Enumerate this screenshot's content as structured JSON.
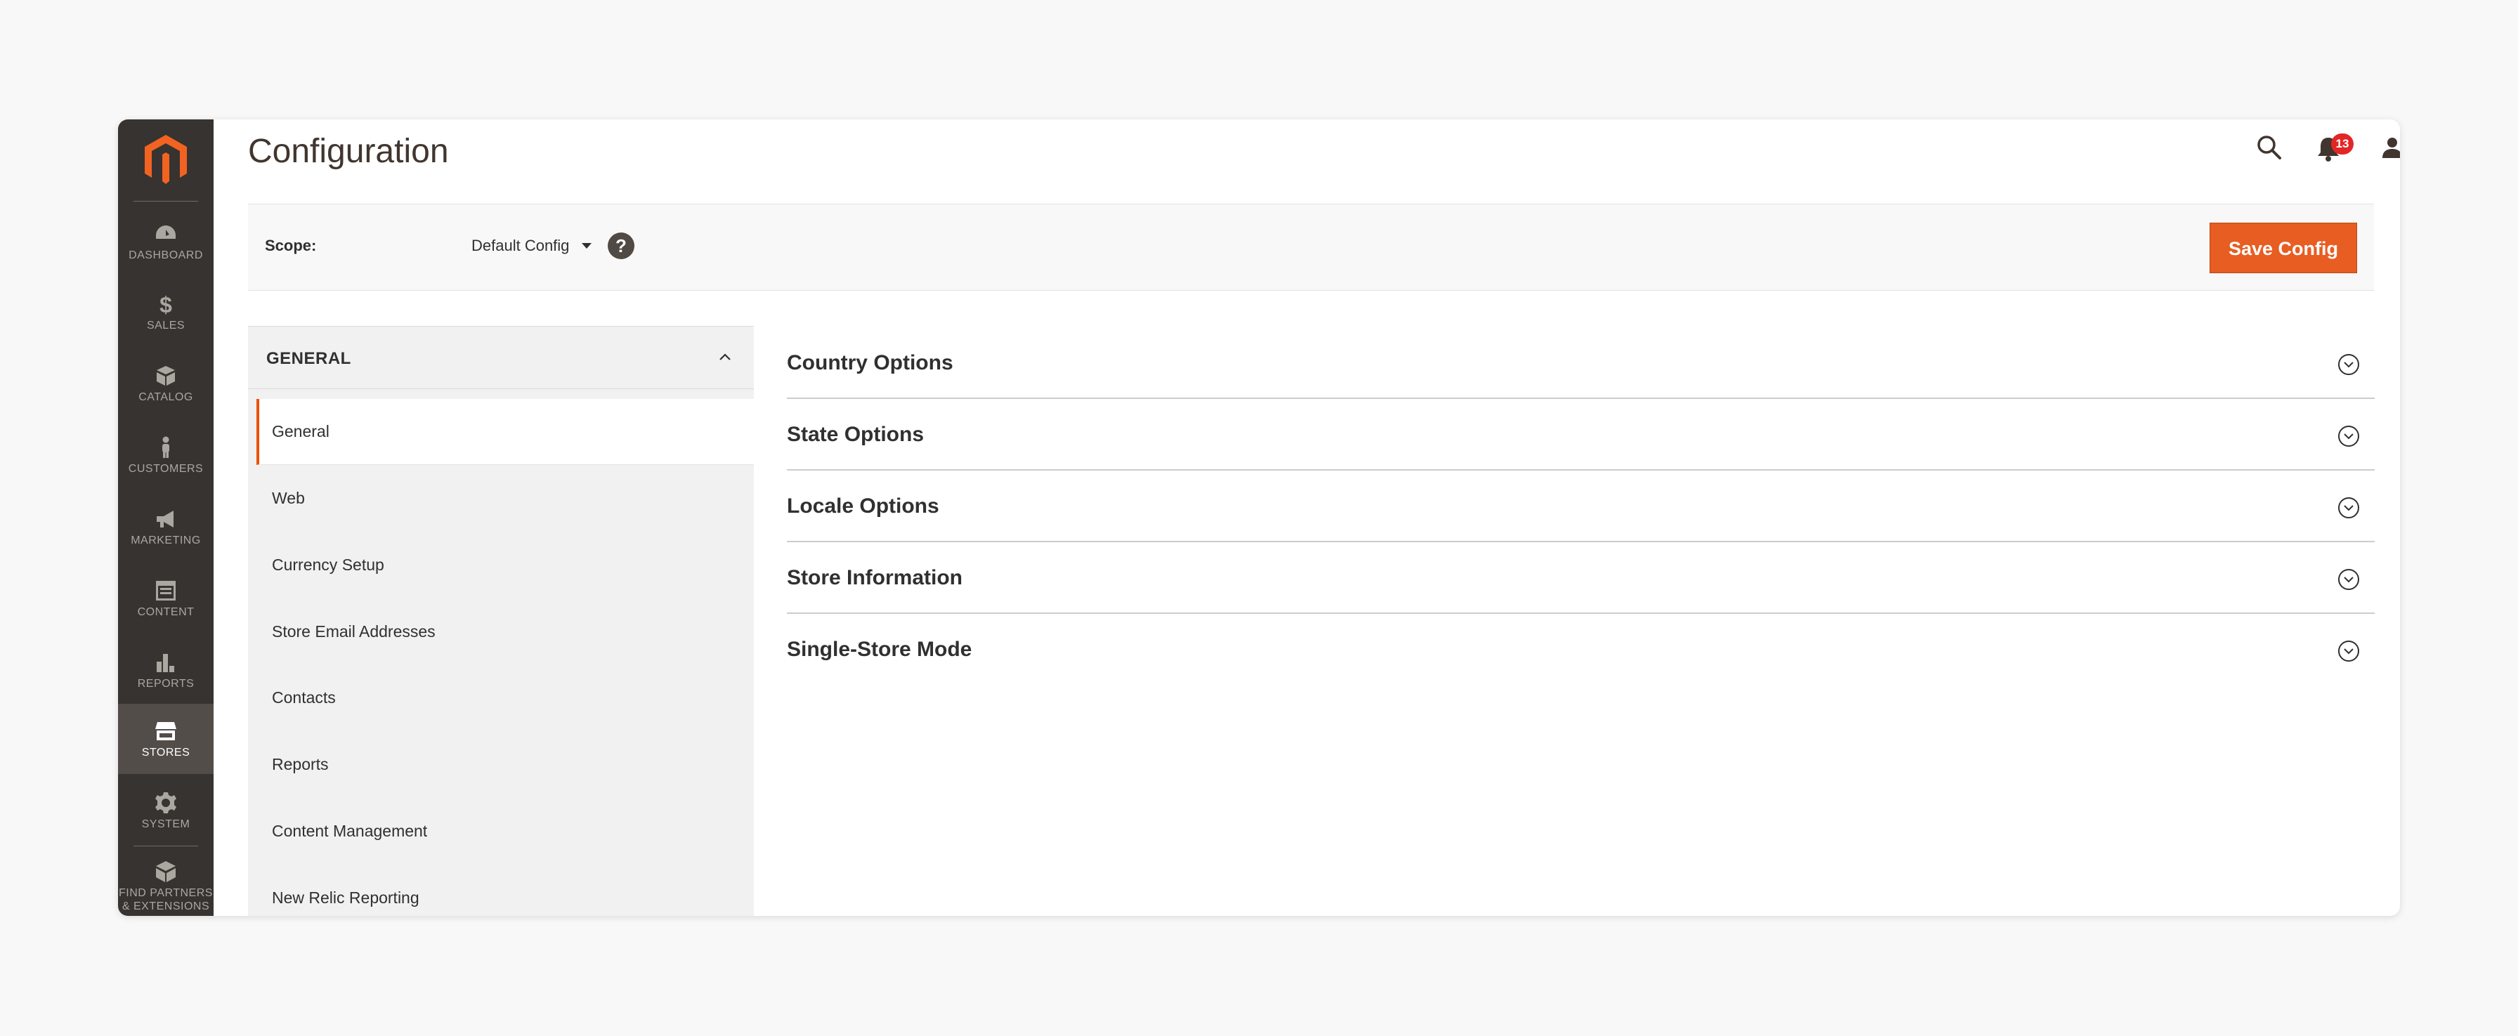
{
  "nav": {
    "items": [
      {
        "label": "Dashboard",
        "icon": "dashboard-icon"
      },
      {
        "label": "Sales",
        "icon": "dollar-icon"
      },
      {
        "label": "Catalog",
        "icon": "box-icon"
      },
      {
        "label": "Customers",
        "icon": "person-icon"
      },
      {
        "label": "Marketing",
        "icon": "megaphone-icon"
      },
      {
        "label": "Content",
        "icon": "layout-icon"
      },
      {
        "label": "Reports",
        "icon": "bar-chart-icon"
      },
      {
        "label": "Stores",
        "icon": "storefront-icon"
      },
      {
        "label": "System",
        "icon": "gear-icon"
      },
      {
        "label": "Find Partners & Extensions",
        "icon": "cubes-icon"
      }
    ],
    "active": "Stores"
  },
  "header": {
    "title": "Configuration",
    "notifications_count": "13",
    "user": "admin"
  },
  "scope": {
    "label": "Scope:",
    "value": "Default Config",
    "help": "?",
    "save_label": "Save Config"
  },
  "tabs": {
    "group_title": "GENERAL",
    "items": [
      {
        "label": "General",
        "active": true
      },
      {
        "label": "Web"
      },
      {
        "label": "Currency Setup"
      },
      {
        "label": "Store Email Addresses"
      },
      {
        "label": "Contacts"
      },
      {
        "label": "Reports"
      },
      {
        "label": "Content Management"
      },
      {
        "label": "New Relic Reporting"
      }
    ]
  },
  "sections": [
    {
      "title": "Country Options"
    },
    {
      "title": "State Options"
    },
    {
      "title": "Locale Options"
    },
    {
      "title": "Store Information"
    },
    {
      "title": "Single-Store Mode"
    }
  ],
  "colors": {
    "nav_bg": "#373330",
    "accent": "#eb5202",
    "button": "#e85d22",
    "badge": "#e22626"
  }
}
